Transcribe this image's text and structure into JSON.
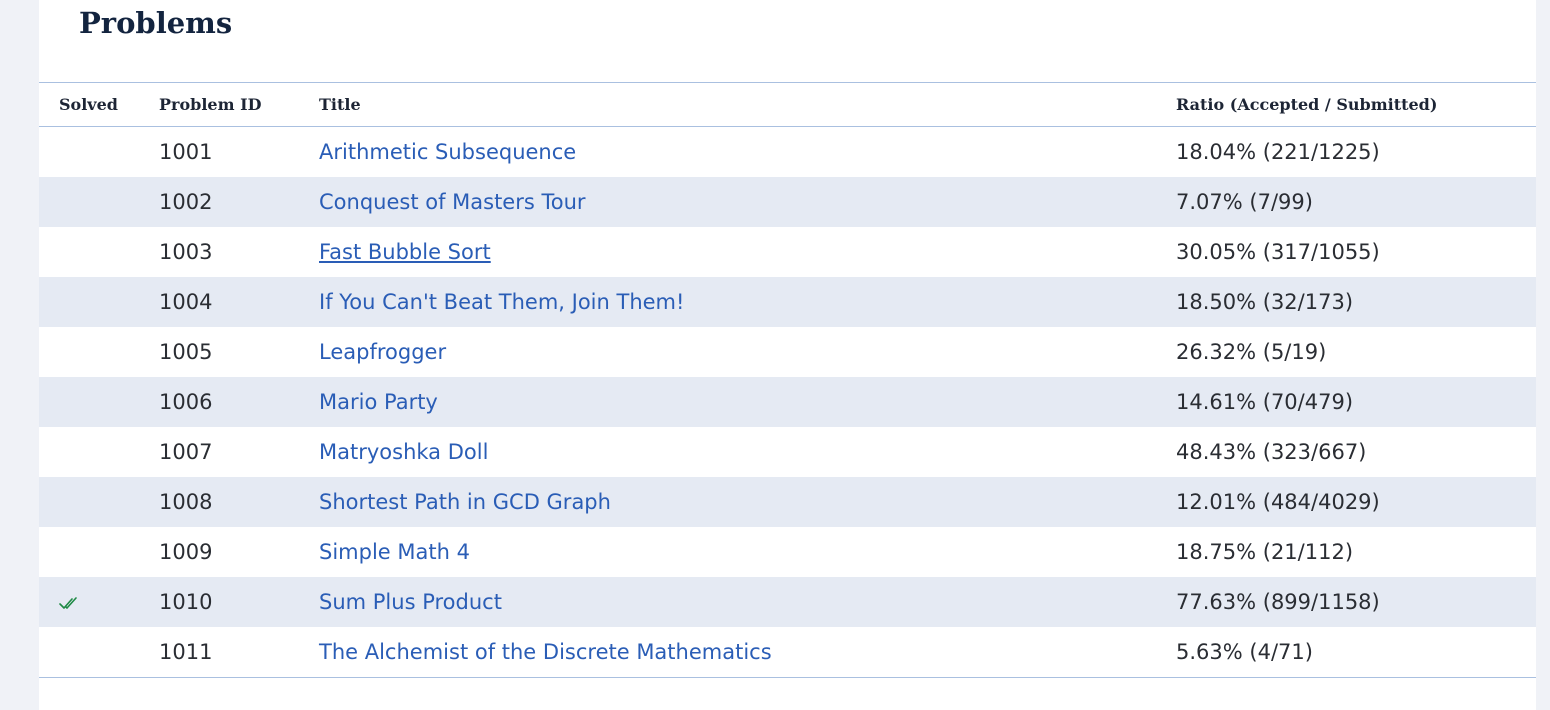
{
  "page": {
    "title": "Problems"
  },
  "table": {
    "headers": {
      "solved": "Solved",
      "problem_id": "Problem ID",
      "title": "Title",
      "ratio": "Ratio (Accepted / Submitted)"
    },
    "rows": [
      {
        "id": "1001",
        "title": "Arithmetic Subsequence",
        "ratio": "18.04% (221/1225)",
        "solved": false
      },
      {
        "id": "1002",
        "title": "Conquest of Masters Tour",
        "ratio": "7.07% (7/99)",
        "solved": false
      },
      {
        "id": "1003",
        "title": "Fast Bubble Sort",
        "ratio": "30.05% (317/1055)",
        "solved": false
      },
      {
        "id": "1004",
        "title": "If You Can't Beat Them, Join Them!",
        "ratio": "18.50% (32/173)",
        "solved": false
      },
      {
        "id": "1005",
        "title": "Leapfrogger",
        "ratio": "26.32% (5/19)",
        "solved": false
      },
      {
        "id": "1006",
        "title": "Mario Party",
        "ratio": "14.61% (70/479)",
        "solved": false
      },
      {
        "id": "1007",
        "title": "Matryoshka Doll",
        "ratio": "48.43% (323/667)",
        "solved": false
      },
      {
        "id": "1008",
        "title": "Shortest Path in GCD Graph",
        "ratio": "12.01% (484/4029)",
        "solved": false
      },
      {
        "id": "1009",
        "title": "Simple Math 4",
        "ratio": "18.75% (21/112)",
        "solved": false
      },
      {
        "id": "1010",
        "title": "Sum Plus Product",
        "ratio": "77.63% (899/1158)",
        "solved": true
      },
      {
        "id": "1011",
        "title": "The Alchemist of the Discrete Mathematics",
        "ratio": "5.63% (4/71)",
        "solved": false
      }
    ]
  },
  "icons": {
    "solved": "double-check-icon"
  },
  "colors": {
    "link": "#2a5db6",
    "check": "#1e8a45",
    "stripe": "#e5eaf3",
    "border": "#aac0e0"
  }
}
